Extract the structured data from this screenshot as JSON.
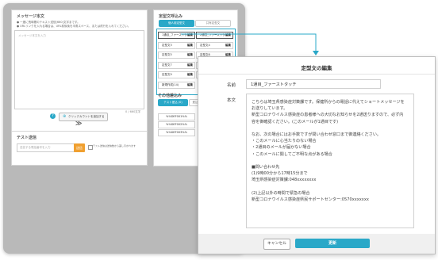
{
  "colors": {
    "accent": "#2aa8c8",
    "button_orange": "#f0a030",
    "window_bg": "#b9b9b9"
  },
  "message_panel": {
    "title": "メッセージ本文",
    "note1": "● 一度に長時間のテキスト送信(660)文字まです。",
    "note2": "● URLリンクを入れる場合は、URL前後後を半角スペース、または改行を入れてください。",
    "placeholder": "メッセージ本文を入力",
    "char_count": "0 / 660文字",
    "help_icon": "question-circle-icon",
    "click_count_button": "クリックカウントを追加する",
    "chevron_icon": "double-chevron-down-icon"
  },
  "test_panel": {
    "title": "テスト送信",
    "input_placeholder": "送信する電話番号を入力",
    "send_button": "送信",
    "checkbox_label": "テスト送信は送信数から差し引かれます"
  },
  "template_panel": {
    "title": "定型文呼込み",
    "tabs": [
      {
        "label": "個人用定型文"
      },
      {
        "label": "共有定型文"
      }
    ],
    "rows": [
      [
        "1通目_ファーストタッチ",
        "編集",
        "2通目_ファーストタッチ",
        "編集"
      ],
      [
        "定型文3",
        "編集",
        "定型文4",
        "編集"
      ],
      [
        "定型文5",
        "編集",
        "定型文6",
        "編集"
      ],
      [
        "定型文7",
        "編集",
        "定型文8",
        "編集"
      ],
      [
        "定型文9",
        "編集",
        "定型文10",
        "編集"
      ],
      [
        "新規作成(14)",
        "編集",
        "",
        ""
      ]
    ]
  },
  "variable_panel": {
    "title": "その他差込み",
    "tabs": [
      {
        "label": "テスト差込 (0)"
      },
      {
        "label": "差込"
      }
    ],
    "items": [
      "%%DEF001%%",
      "%%DEF002%%",
      "%%DEF003%%"
    ]
  },
  "modal": {
    "title": "定型文の編集",
    "name_label": "名前",
    "name_value": "1通目_ファーストタッチ",
    "body_label": "本文",
    "body_text": "こちらは埼玉県感染症対策課です。保健所からの電話に代えてショートメッセージを\nお送りしています。\n新型コロナウイルス感染症の患者様への大切なお知らせを2通送りますので、必ず内\n容を御確認ください。(このメールが1通目です)\n\nなお、次の場合にはお手数ですが問い合わせ窓口まで御連絡ください。\n・このメールに心当たりのない場合\n・2通目のメールが届かない場合\n・このメールに関してご不明な点がある場合\n\n■問い合わせ先\n(1)9時00分から17時15分まで\n埼玉県感染症対策課:048xxxxxxxx\n\n(2)上記以外の時間で緊急の場合\n新型コロナウイルス感染症県民サポートセンター:0570xxxxxxx",
    "cancel_button": "キャンセル",
    "update_button": "更新"
  }
}
